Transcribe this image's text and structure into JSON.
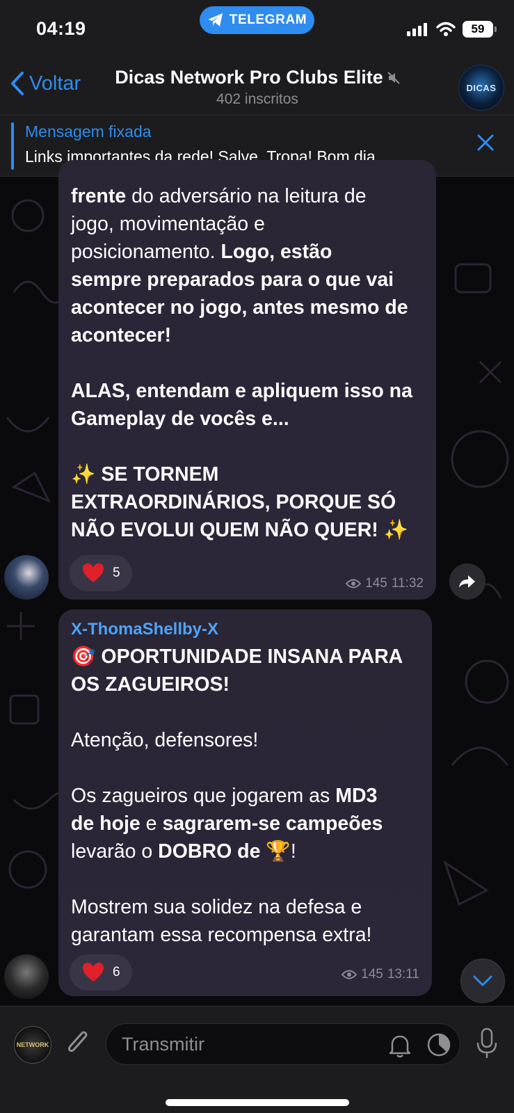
{
  "status_bar": {
    "time": "04:19",
    "app_pill": "TELEGRAM",
    "battery": "59"
  },
  "header": {
    "back_label": "Voltar",
    "title": "Dicas Network Pro Clubs Elite",
    "subtitle": "402 inscritos",
    "avatar_text": "DICAS"
  },
  "pinned": {
    "title": "Mensagem fixada",
    "text": "Links importantes da rede! Salve, Tropa! Bom dia...."
  },
  "messages": [
    {
      "lines": {
        "l1_b": "frente",
        "l1_r": " do adversário na leitura de",
        "l2": "jogo, movimentação e",
        "l3_r": "posicionamento. ",
        "l3_b": "Logo, estão",
        "l4": "sempre preparados para o que vai",
        "l5": "acontecer no jogo, antes mesmo de",
        "l6": "acontecer!",
        "p2_l1": "ALAS, entendam e apliquem isso na",
        "p2_l2": "Gameplay de vocês e...",
        "p3_l1": "✨ SE TORNEM",
        "p3_l2": "EXTRAORDINÁRIOS, PORQUE SÓ",
        "p3_l3": "NÃO EVOLUI QUEM NÃO QUER! ✨"
      },
      "reaction_count": "5",
      "views": "145",
      "time": "11:32"
    },
    {
      "sender": "X-ThomaShellby-X",
      "lines": {
        "h1": "🎯 OPORTUNIDADE INSANA PARA",
        "h2": "OS ZAGUEIROS!",
        "a1": "Atenção, defensores!",
        "b1_r": "Os zagueiros que jogarem as ",
        "b1_b": "MD3",
        "b2_b1": "de hoje",
        "b2_r": " e ",
        "b2_b2": "sagrarem-se campeões",
        "b3_r": "levarão o ",
        "b3_b": "DOBRO de",
        "b3_e": " 🏆!",
        "c1": "Mostrem sua solidez na defesa e",
        "c2": "garantam essa recompensa extra!"
      },
      "reaction_count": "6",
      "views": "145",
      "time": "13:11"
    }
  ],
  "input": {
    "placeholder": "Transmitir",
    "channel_avatar_text": "NETWORK"
  },
  "colors": {
    "accent": "#2f8cf0",
    "bubble": "#2a2636",
    "sender": "#4fa3f7",
    "reaction_heart": "#e0202a"
  },
  "icons": [
    "telegram-plane-icon",
    "signal-icon",
    "wifi-icon",
    "mute-icon",
    "close-icon",
    "heart-icon",
    "eye-icon",
    "share-icon",
    "chevron-down-icon",
    "attach-icon",
    "bell-icon",
    "timer-icon",
    "mic-icon"
  ]
}
